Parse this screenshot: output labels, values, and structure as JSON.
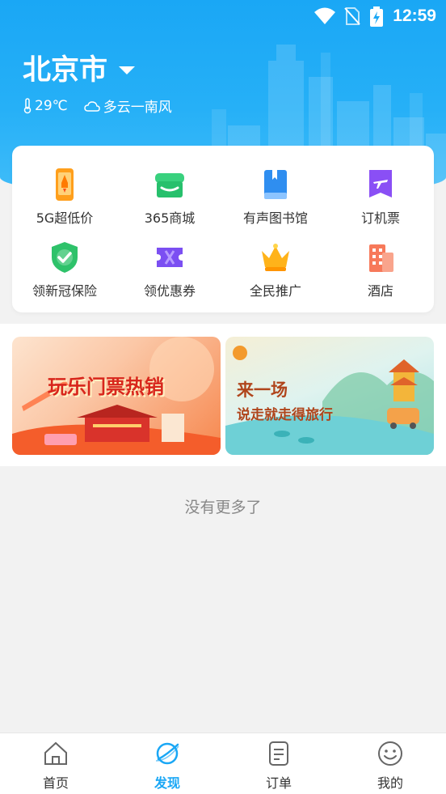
{
  "status_bar": {
    "time": "12:59"
  },
  "location": {
    "city": "北京市"
  },
  "weather": {
    "temperature": "29℃",
    "condition": "多云一南风"
  },
  "menu": [
    {
      "label": "5G超低价",
      "icon": "phone-rocket-icon"
    },
    {
      "label": "365商城",
      "icon": "store-icon"
    },
    {
      "label": "有声图书馆",
      "icon": "book-icon"
    },
    {
      "label": "订机票",
      "icon": "plane-ticket-icon"
    },
    {
      "label": "领新冠保险",
      "icon": "shield-check-icon"
    },
    {
      "label": "领优惠券",
      "icon": "coupon-icon"
    },
    {
      "label": "全民推广",
      "icon": "crown-icon"
    },
    {
      "label": "酒店",
      "icon": "hotel-icon"
    }
  ],
  "banners": [
    {
      "title": "玩乐门票热销"
    },
    {
      "title": "来一场",
      "subtitle": "说走就走得旅行"
    }
  ],
  "footer_text": "没有更多了",
  "tabs": [
    {
      "label": "首页",
      "icon": "home-icon"
    },
    {
      "label": "发现",
      "icon": "planet-icon",
      "active": true
    },
    {
      "label": "订单",
      "icon": "order-icon"
    },
    {
      "label": "我的",
      "icon": "smile-icon"
    }
  ],
  "colors": {
    "accent": "#1aa7f5",
    "orange": "#ff8c1a",
    "purple": "#7b4ff2"
  }
}
